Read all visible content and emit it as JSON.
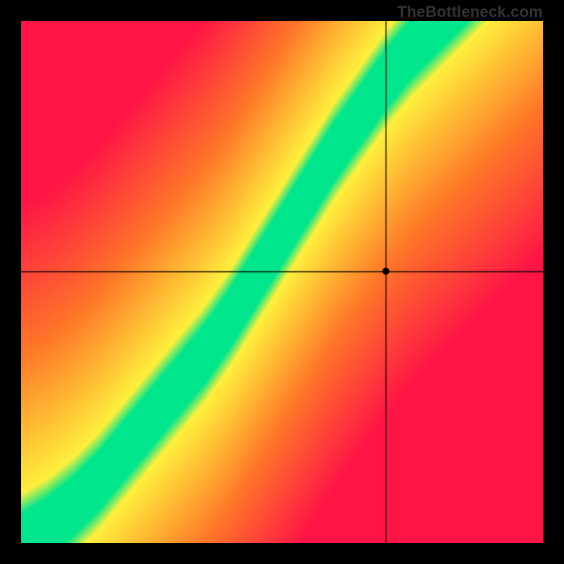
{
  "watermark": "TheBottleneck.com",
  "chart_data": {
    "type": "heatmap",
    "title": "",
    "xlabel": "",
    "ylabel": "",
    "xlim": [
      0,
      1
    ],
    "ylim": [
      0,
      1
    ],
    "crosshair": {
      "x": 0.7,
      "y": 0.52
    },
    "marker": {
      "x": 0.7,
      "y": 0.52
    },
    "optimal_curve": [
      {
        "x": 0.0,
        "y": 0.0
      },
      {
        "x": 0.05,
        "y": 0.03
      },
      {
        "x": 0.1,
        "y": 0.07
      },
      {
        "x": 0.15,
        "y": 0.12
      },
      {
        "x": 0.2,
        "y": 0.18
      },
      {
        "x": 0.25,
        "y": 0.24
      },
      {
        "x": 0.3,
        "y": 0.3
      },
      {
        "x": 0.35,
        "y": 0.36
      },
      {
        "x": 0.4,
        "y": 0.43
      },
      {
        "x": 0.45,
        "y": 0.51
      },
      {
        "x": 0.5,
        "y": 0.59
      },
      {
        "x": 0.55,
        "y": 0.67
      },
      {
        "x": 0.6,
        "y": 0.75
      },
      {
        "x": 0.65,
        "y": 0.82
      },
      {
        "x": 0.7,
        "y": 0.89
      },
      {
        "x": 0.75,
        "y": 0.95
      },
      {
        "x": 0.8,
        "y": 1.0
      }
    ],
    "band_half_width": 0.055,
    "color_scale": "red-orange-yellow-green (distance from optimal curve)"
  }
}
